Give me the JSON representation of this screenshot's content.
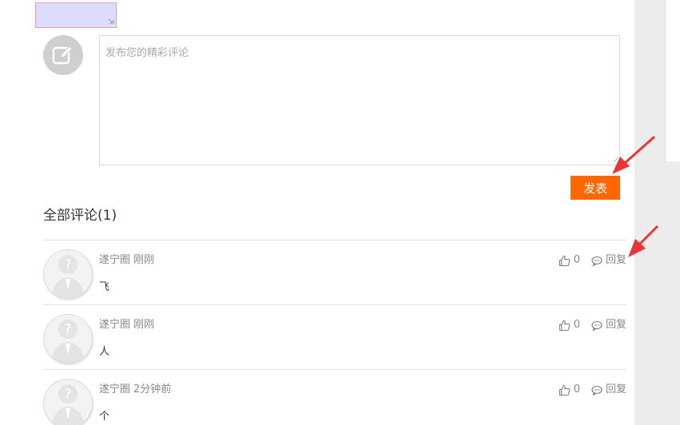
{
  "compose": {
    "placeholder": "发布您的精彩评论",
    "submit_label": "发表",
    "avatar_icon": "edit-icon"
  },
  "comments_header": {
    "title": "全部评论(1)"
  },
  "comments": [
    {
      "author": "遂宁圈",
      "time": "刚刚",
      "content": "飞",
      "likes": "0",
      "reply_label": "回复"
    },
    {
      "author": "遂宁圈",
      "time": "刚刚",
      "content": "人",
      "likes": "0",
      "reply_label": "回复"
    },
    {
      "author": "遂宁圈",
      "time": "2分钟前",
      "content": "个",
      "likes": "0",
      "reply_label": "回复"
    }
  ],
  "colors": {
    "accent": "#ff6600",
    "annotation_arrow": "#ee3333",
    "sidebar_gray": "#ececec"
  }
}
